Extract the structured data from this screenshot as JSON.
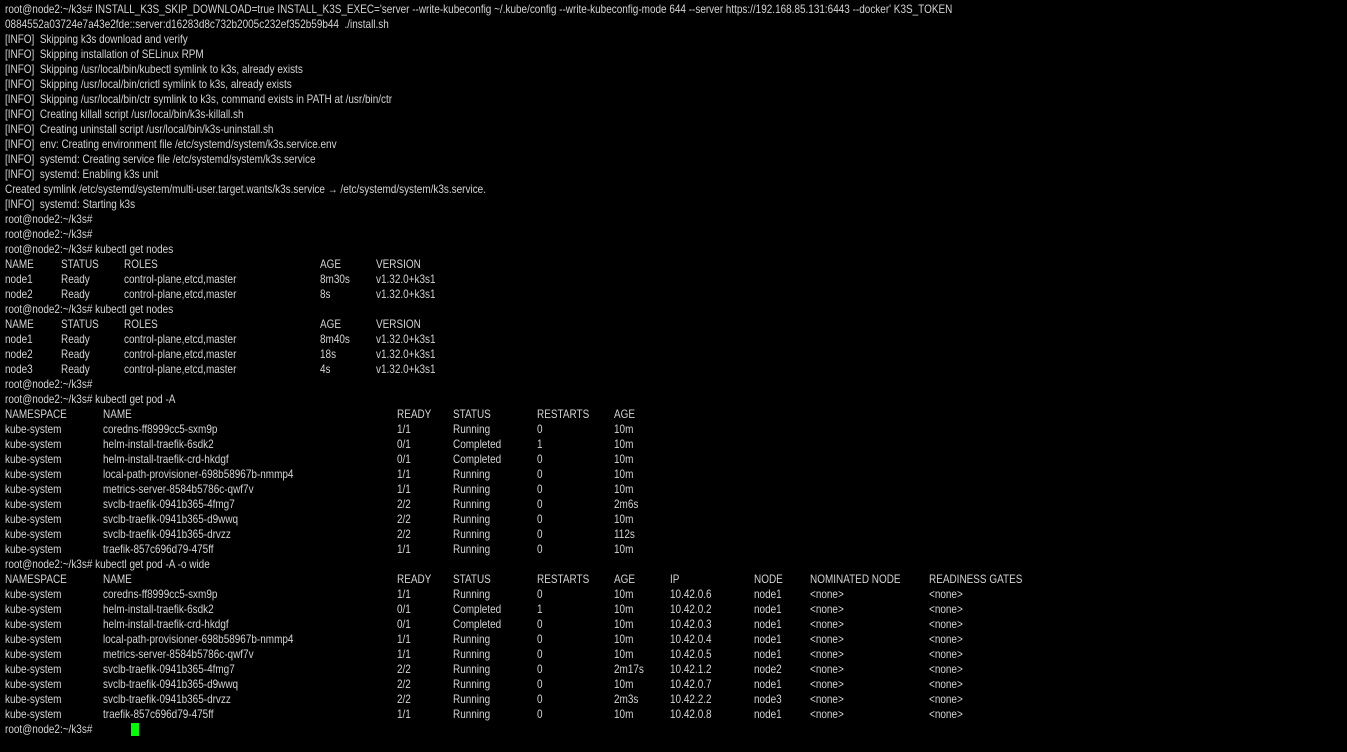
{
  "terminal": {
    "cursor_color": "#00ff00"
  },
  "lines": [
    {
      "text": "root@node2:~/k3s# INSTALL_K3S_SKIP_DOWNLOAD=true INSTALL_K3S_EXEC='server --write-kubeconfig ~/.kube/config --write-kubeconfig-mode 644 --server https://192.168.85.131:6443 --docker' K3S_TOKEN"
    },
    {
      "text": "0884552a03724e7a43e2fde::server:d16283d8c732b2005c232ef352b59b44  ./install.sh"
    },
    {
      "text": "[INFO]  Skipping k3s download and verify"
    },
    {
      "text": "[INFO]  Skipping installation of SELinux RPM"
    },
    {
      "text": "[INFO]  Skipping /usr/local/bin/kubectl symlink to k3s, already exists"
    },
    {
      "text": "[INFO]  Skipping /usr/local/bin/crictl symlink to k3s, already exists"
    },
    {
      "text": "[INFO]  Skipping /usr/local/bin/ctr symlink to k3s, command exists in PATH at /usr/bin/ctr"
    },
    {
      "text": "[INFO]  Creating killall script /usr/local/bin/k3s-killall.sh"
    },
    {
      "text": "[INFO]  Creating uninstall script /usr/local/bin/k3s-uninstall.sh"
    },
    {
      "text": "[INFO]  env: Creating environment file /etc/systemd/system/k3s.service.env"
    },
    {
      "text": "[INFO]  systemd: Creating service file /etc/systemd/system/k3s.service"
    },
    {
      "text": "[INFO]  systemd: Enabling k3s unit"
    },
    {
      "text": "Created symlink /etc/systemd/system/multi-user.target.wants/k3s.service → /etc/systemd/system/k3s.service."
    },
    {
      "text": "[INFO]  systemd: Starting k3s"
    },
    {
      "text": "root@node2:~/k3s#"
    },
    {
      "text": "root@node2:~/k3s#"
    },
    {
      "text": "root@node2:~/k3s# kubectl get nodes"
    },
    {
      "table": "nodes",
      "cells": [
        "NAME",
        "STATUS",
        "ROLES",
        "AGE",
        "VERSION"
      ]
    },
    {
      "table": "nodes",
      "cells": [
        "node1",
        "Ready",
        "control-plane,etcd,master",
        "8m30s",
        "v1.32.0+k3s1"
      ]
    },
    {
      "table": "nodes",
      "cells": [
        "node2",
        "Ready",
        "control-plane,etcd,master",
        "8s",
        "v1.32.0+k3s1"
      ]
    },
    {
      "text": "root@node2:~/k3s# kubectl get nodes"
    },
    {
      "table": "nodes",
      "cells": [
        "NAME",
        "STATUS",
        "ROLES",
        "AGE",
        "VERSION"
      ]
    },
    {
      "table": "nodes",
      "cells": [
        "node1",
        "Ready",
        "control-plane,etcd,master",
        "8m40s",
        "v1.32.0+k3s1"
      ]
    },
    {
      "table": "nodes",
      "cells": [
        "node2",
        "Ready",
        "control-plane,etcd,master",
        "18s",
        "v1.32.0+k3s1"
      ]
    },
    {
      "table": "nodes",
      "cells": [
        "node3",
        "Ready",
        "control-plane,etcd,master",
        "4s",
        "v1.32.0+k3s1"
      ]
    },
    {
      "text": "root@node2:~/k3s#"
    },
    {
      "text": "root@node2:~/k3s# kubectl get pod -A"
    },
    {
      "table": "pods",
      "cells": [
        "NAMESPACE",
        "NAME",
        "READY",
        "STATUS",
        "RESTARTS",
        "AGE"
      ]
    },
    {
      "table": "pods",
      "cells": [
        "kube-system",
        "coredns-ff8999cc5-sxm9p",
        "1/1",
        "Running",
        "0",
        "10m"
      ]
    },
    {
      "table": "pods",
      "cells": [
        "kube-system",
        "helm-install-traefik-6sdk2",
        "0/1",
        "Completed",
        "1",
        "10m"
      ]
    },
    {
      "table": "pods",
      "cells": [
        "kube-system",
        "helm-install-traefik-crd-hkdgf",
        "0/1",
        "Completed",
        "0",
        "10m"
      ]
    },
    {
      "table": "pods",
      "cells": [
        "kube-system",
        "local-path-provisioner-698b58967b-nmmp4",
        "1/1",
        "Running",
        "0",
        "10m"
      ]
    },
    {
      "table": "pods",
      "cells": [
        "kube-system",
        "metrics-server-8584b5786c-qwf7v",
        "1/1",
        "Running",
        "0",
        "10m"
      ]
    },
    {
      "table": "pods",
      "cells": [
        "kube-system",
        "svclb-traefik-0941b365-4fmg7",
        "2/2",
        "Running",
        "0",
        "2m6s"
      ]
    },
    {
      "table": "pods",
      "cells": [
        "kube-system",
        "svclb-traefik-0941b365-d9wwq",
        "2/2",
        "Running",
        "0",
        "10m"
      ]
    },
    {
      "table": "pods",
      "cells": [
        "kube-system",
        "svclb-traefik-0941b365-drvzz",
        "2/2",
        "Running",
        "0",
        "112s"
      ]
    },
    {
      "table": "pods",
      "cells": [
        "kube-system",
        "traefik-857c696d79-475ff",
        "1/1",
        "Running",
        "0",
        "10m"
      ]
    },
    {
      "text": "root@node2:~/k3s# kubectl get pod -A -o wide"
    },
    {
      "table": "wide",
      "cells": [
        "NAMESPACE",
        "NAME",
        "READY",
        "STATUS",
        "RESTARTS",
        "AGE",
        "IP",
        "NODE",
        "NOMINATED NODE",
        "READINESS GATES"
      ]
    },
    {
      "table": "wide",
      "cells": [
        "kube-system",
        "coredns-ff8999cc5-sxm9p",
        "1/1",
        "Running",
        "0",
        "10m",
        "10.42.0.6",
        "node1",
        "<none>",
        "<none>"
      ]
    },
    {
      "table": "wide",
      "cells": [
        "kube-system",
        "helm-install-traefik-6sdk2",
        "0/1",
        "Completed",
        "1",
        "10m",
        "10.42.0.2",
        "node1",
        "<none>",
        "<none>"
      ]
    },
    {
      "table": "wide",
      "cells": [
        "kube-system",
        "helm-install-traefik-crd-hkdgf",
        "0/1",
        "Completed",
        "0",
        "10m",
        "10.42.0.3",
        "node1",
        "<none>",
        "<none>"
      ]
    },
    {
      "table": "wide",
      "cells": [
        "kube-system",
        "local-path-provisioner-698b58967b-nmmp4",
        "1/1",
        "Running",
        "0",
        "10m",
        "10.42.0.4",
        "node1",
        "<none>",
        "<none>"
      ]
    },
    {
      "table": "wide",
      "cells": [
        "kube-system",
        "metrics-server-8584b5786c-qwf7v",
        "1/1",
        "Running",
        "0",
        "10m",
        "10.42.0.5",
        "node1",
        "<none>",
        "<none>"
      ]
    },
    {
      "table": "wide",
      "cells": [
        "kube-system",
        "svclb-traefik-0941b365-4fmg7",
        "2/2",
        "Running",
        "0",
        "2m17s",
        "10.42.1.2",
        "node2",
        "<none>",
        "<none>"
      ]
    },
    {
      "table": "wide",
      "cells": [
        "kube-system",
        "svclb-traefik-0941b365-d9wwq",
        "2/2",
        "Running",
        "0",
        "10m",
        "10.42.0.7",
        "node1",
        "<none>",
        "<none>"
      ]
    },
    {
      "table": "wide",
      "cells": [
        "kube-system",
        "svclb-traefik-0941b365-drvzz",
        "2/2",
        "Running",
        "0",
        "2m3s",
        "10.42.2.2",
        "node3",
        "<none>",
        "<none>"
      ]
    },
    {
      "table": "wide",
      "cells": [
        "kube-system",
        "traefik-857c696d79-475ff",
        "1/1",
        "Running",
        "0",
        "10m",
        "10.42.0.8",
        "node1",
        "<none>",
        "<none>"
      ]
    },
    {
      "text": "root@node2:~/k3s#",
      "cursor": true
    }
  ]
}
